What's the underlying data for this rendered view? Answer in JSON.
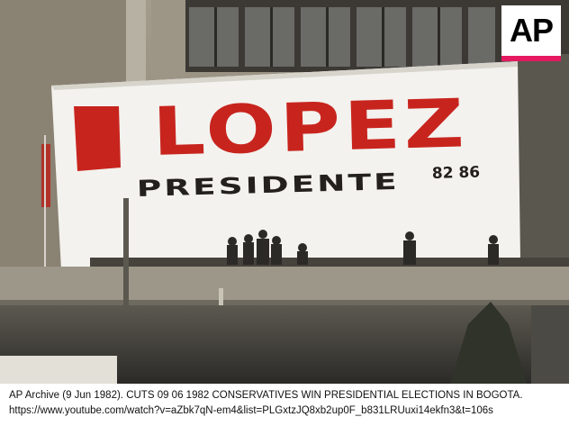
{
  "photo": {
    "banner_main": "LOPEZ",
    "banner_sub": "PRESIDENTE",
    "banner_years": "82 86",
    "logo_text": "AP",
    "colors": {
      "banner_red": "#c8241e",
      "banner_white": "#f3f2ee",
      "logo_stripe": "#e5195f",
      "building_stone": "#8e8879",
      "facade_dark": "#3a3733"
    }
  },
  "caption": {
    "line1": "AP Archive (9 Jun 1982). CUTS 09 06 1982 CONSERVATIVES WIN PRESIDENTIAL ELECTIONS IN BOGOTA.",
    "line2": "https://www.youtube.com/watch?v=aZbk7qN-em4&list=PLGxtzJQ8xb2up0F_b831LRUuxi14ekfn3&t=106s"
  }
}
